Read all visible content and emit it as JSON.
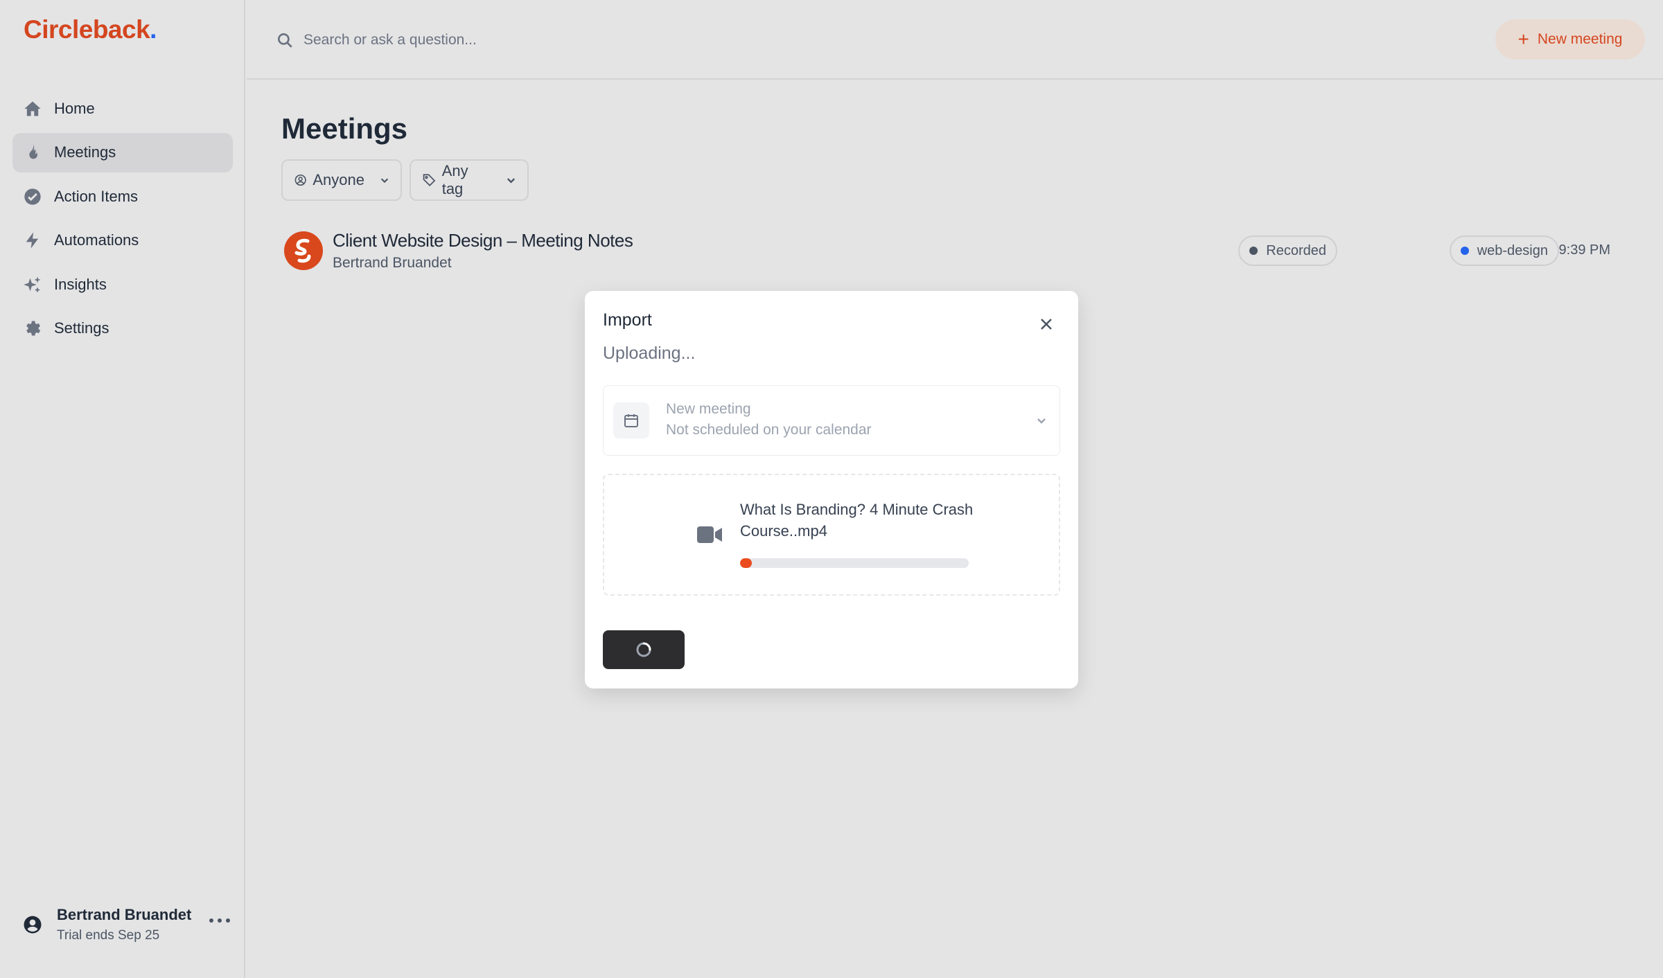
{
  "app": {
    "brand": "Circleback",
    "brand_dot": ".",
    "brand_color": "#d4461f",
    "accent_dot_color": "#2563eb"
  },
  "sidebar": {
    "items": [
      {
        "label": "Home",
        "icon": "home-icon",
        "active": false
      },
      {
        "label": "Meetings",
        "icon": "flame-icon",
        "active": true
      },
      {
        "label": "Action Items",
        "icon": "check-circle-icon",
        "active": false
      },
      {
        "label": "Automations",
        "icon": "bolt-icon",
        "active": false
      },
      {
        "label": "Insights",
        "icon": "sparkles-icon",
        "active": false
      },
      {
        "label": "Settings",
        "icon": "gear-icon",
        "active": false
      }
    ],
    "user": {
      "name": "Bertrand Bruandet",
      "subtitle": "Trial ends Sep 25"
    }
  },
  "topbar": {
    "search_placeholder": "Search or ask a question...",
    "new_meeting_label": "New meeting"
  },
  "main": {
    "title": "Meetings",
    "filters": [
      {
        "label": "Anyone",
        "icon": "user-circle-icon"
      },
      {
        "label": "Any tag",
        "icon": "tag-icon"
      }
    ],
    "meetings": [
      {
        "title": "Client Website Design – Meeting Notes",
        "author": "Bertrand Bruandet",
        "tags": [
          {
            "label": "Recorded",
            "color": "#4b5563"
          },
          {
            "label": "web-design",
            "color": "#2563eb"
          }
        ],
        "time": "9:39 PM"
      }
    ]
  },
  "modal": {
    "title": "Import",
    "status": "Uploading...",
    "meeting_select": {
      "title": "New meeting",
      "subtitle": "Not scheduled on your calendar"
    },
    "file": {
      "name": "What Is Branding? 4 Minute Crash Course..mp4",
      "progress": 0.05,
      "progress_color": "#ea4b1f"
    }
  }
}
